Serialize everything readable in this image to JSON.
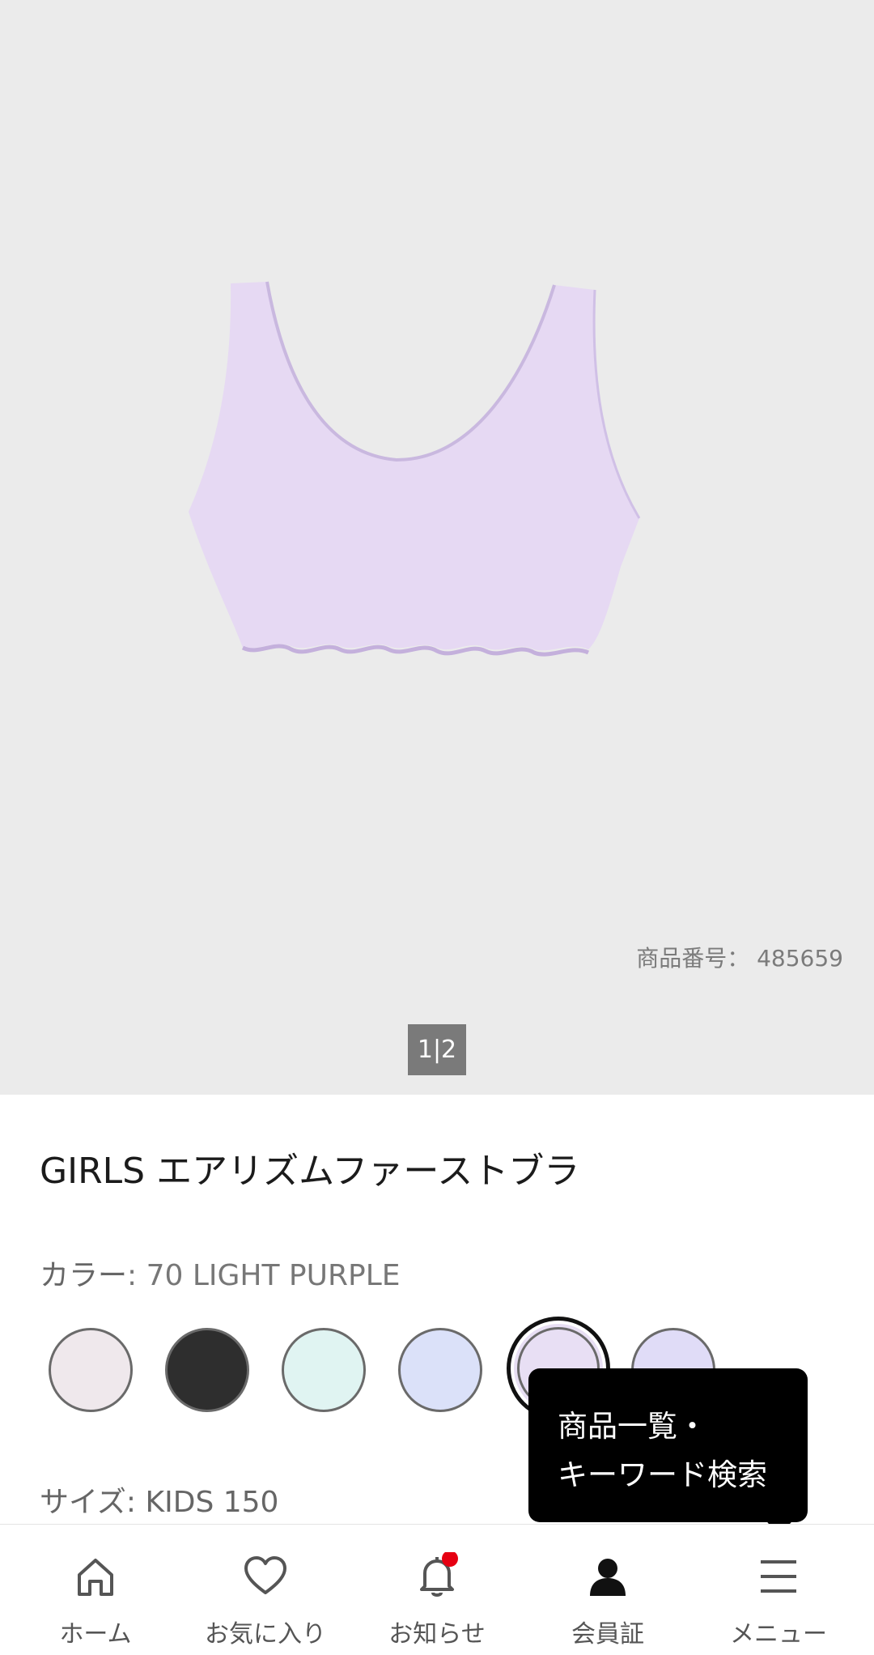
{
  "product": {
    "number_label": "商品番号：",
    "number": "485659",
    "pager": "1|2",
    "title": "GIRLS エアリズムファーストブラ"
  },
  "color": {
    "label": "カラー",
    "value": ": 70 LIGHT PURPLE",
    "swatches": [
      {
        "name": "light-pink",
        "hex": "#efe8ec"
      },
      {
        "name": "black",
        "hex": "#2e2e2e"
      },
      {
        "name": "mint",
        "hex": "#e0f4f2"
      },
      {
        "name": "periwinkle",
        "hex": "#dbe1f9"
      },
      {
        "name": "light-purple",
        "hex": "#e8dff4",
        "selected": true
      },
      {
        "name": "lavender",
        "hex": "#e0dcf7"
      }
    ]
  },
  "size": {
    "label": "サイズ",
    "value": ": KIDS 150"
  },
  "tooltip": {
    "line1": "商品一覧・",
    "line2": "キーワード検索"
  },
  "nav": {
    "items": [
      {
        "label": "ホーム",
        "icon": "home-icon"
      },
      {
        "label": "お気に入り",
        "icon": "heart-icon"
      },
      {
        "label": "お知らせ",
        "icon": "bell-icon",
        "badge_color": "#e60012"
      },
      {
        "label": "会員証",
        "icon": "member-card-icon"
      },
      {
        "label": "メニュー",
        "icon": "menu-icon"
      }
    ]
  }
}
